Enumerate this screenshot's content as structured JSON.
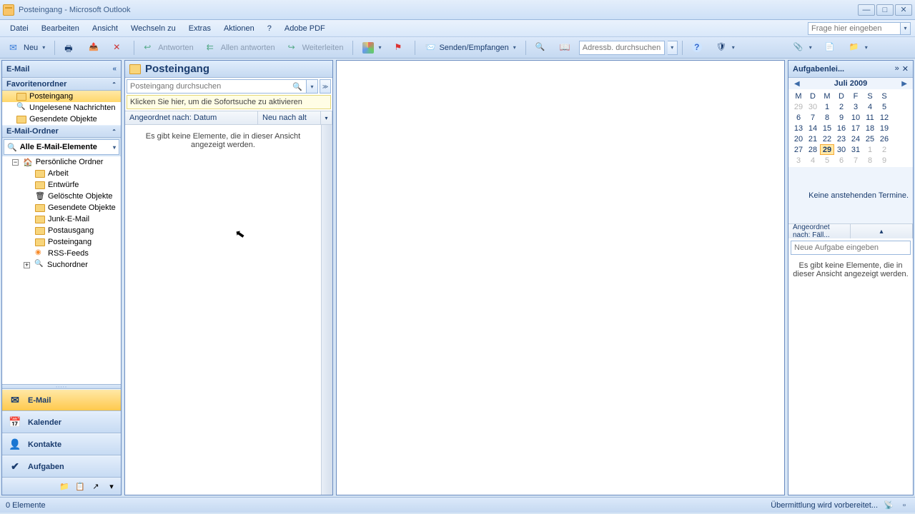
{
  "window": {
    "title": "Posteingang - Microsoft Outlook"
  },
  "menu": {
    "file": "Datei",
    "edit": "Bearbeiten",
    "view": "Ansicht",
    "goto": "Wechseln zu",
    "extras": "Extras",
    "actions": "Aktionen",
    "help": "?",
    "adobe": "Adobe PDF",
    "help_placeholder": "Frage hier eingeben"
  },
  "toolbar": {
    "new": "Neu",
    "reply": "Antworten",
    "reply_all": "Allen antworten",
    "forward": "Weiterleiten",
    "send_receive": "Senden/Empfangen",
    "address_search_placeholder": "Adressb. durchsuchen"
  },
  "nav": {
    "header": "E-Mail",
    "favorites_header": "Favoritenordner",
    "favorites": {
      "inbox": "Posteingang",
      "unread": "Ungelesene Nachrichten",
      "sent": "Gesendete Objekte"
    },
    "mail_folders_header": "E-Mail-Ordner",
    "all_items": "Alle E-Mail-Elemente",
    "personal": "Persönliche Ordner",
    "folders": {
      "work": "Arbeit",
      "drafts": "Entwürfe",
      "deleted": "Gelöschte Objekte",
      "sent": "Gesendete Objekte",
      "junk": "Junk-E-Mail",
      "outbox": "Postausgang",
      "inbox": "Posteingang",
      "rss": "RSS-Feeds",
      "search": "Suchordner"
    },
    "buttons": {
      "mail": "E-Mail",
      "calendar": "Kalender",
      "contacts": "Kontakte",
      "tasks": "Aufgaben"
    }
  },
  "msglist": {
    "title": "Posteingang",
    "search_placeholder": "Posteingang durchsuchen",
    "instant_banner": "Klicken Sie hier, um die Sofortsuche zu aktivieren",
    "sort_by": "Angeordnet nach: Datum",
    "sort_order": "Neu nach alt",
    "empty": "Es gibt keine Elemente, die in dieser Ansicht angezeigt werden."
  },
  "todobar": {
    "header": "Aufgabenlei...",
    "month": "Juli 2009",
    "dow": [
      "M",
      "D",
      "M",
      "D",
      "F",
      "S",
      "S"
    ],
    "weeks": [
      [
        {
          "d": 29,
          "g": true
        },
        {
          "d": 30,
          "g": true
        },
        {
          "d": 1
        },
        {
          "d": 2
        },
        {
          "d": 3
        },
        {
          "d": 4
        },
        {
          "d": 5
        }
      ],
      [
        {
          "d": 6
        },
        {
          "d": 7
        },
        {
          "d": 8
        },
        {
          "d": 9
        },
        {
          "d": 10
        },
        {
          "d": 11
        },
        {
          "d": 12
        }
      ],
      [
        {
          "d": 13
        },
        {
          "d": 14
        },
        {
          "d": 15
        },
        {
          "d": 16
        },
        {
          "d": 17
        },
        {
          "d": 18
        },
        {
          "d": 19
        }
      ],
      [
        {
          "d": 20
        },
        {
          "d": 21
        },
        {
          "d": 22
        },
        {
          "d": 23
        },
        {
          "d": 24
        },
        {
          "d": 25
        },
        {
          "d": 26
        }
      ],
      [
        {
          "d": 27
        },
        {
          "d": 28
        },
        {
          "d": 29,
          "t": true
        },
        {
          "d": 30
        },
        {
          "d": 31
        },
        {
          "d": 1,
          "g": true
        },
        {
          "d": 2,
          "g": true
        }
      ],
      [
        {
          "d": 3,
          "g": true
        },
        {
          "d": 4,
          "g": true
        },
        {
          "d": 5,
          "g": true
        },
        {
          "d": 6,
          "g": true
        },
        {
          "d": 7,
          "g": true
        },
        {
          "d": 8,
          "g": true
        },
        {
          "d": 9,
          "g": true
        }
      ]
    ],
    "no_appts": "Keine anstehenden Termine.",
    "task_sort": "Angeordnet nach: Fäll...",
    "task_placeholder": "Neue Aufgabe eingeben",
    "task_empty": "Es gibt keine Elemente, die in dieser Ansicht angezeigt werden."
  },
  "status": {
    "left": "0 Elemente",
    "right": "Übermittlung wird vorbereitet..."
  }
}
